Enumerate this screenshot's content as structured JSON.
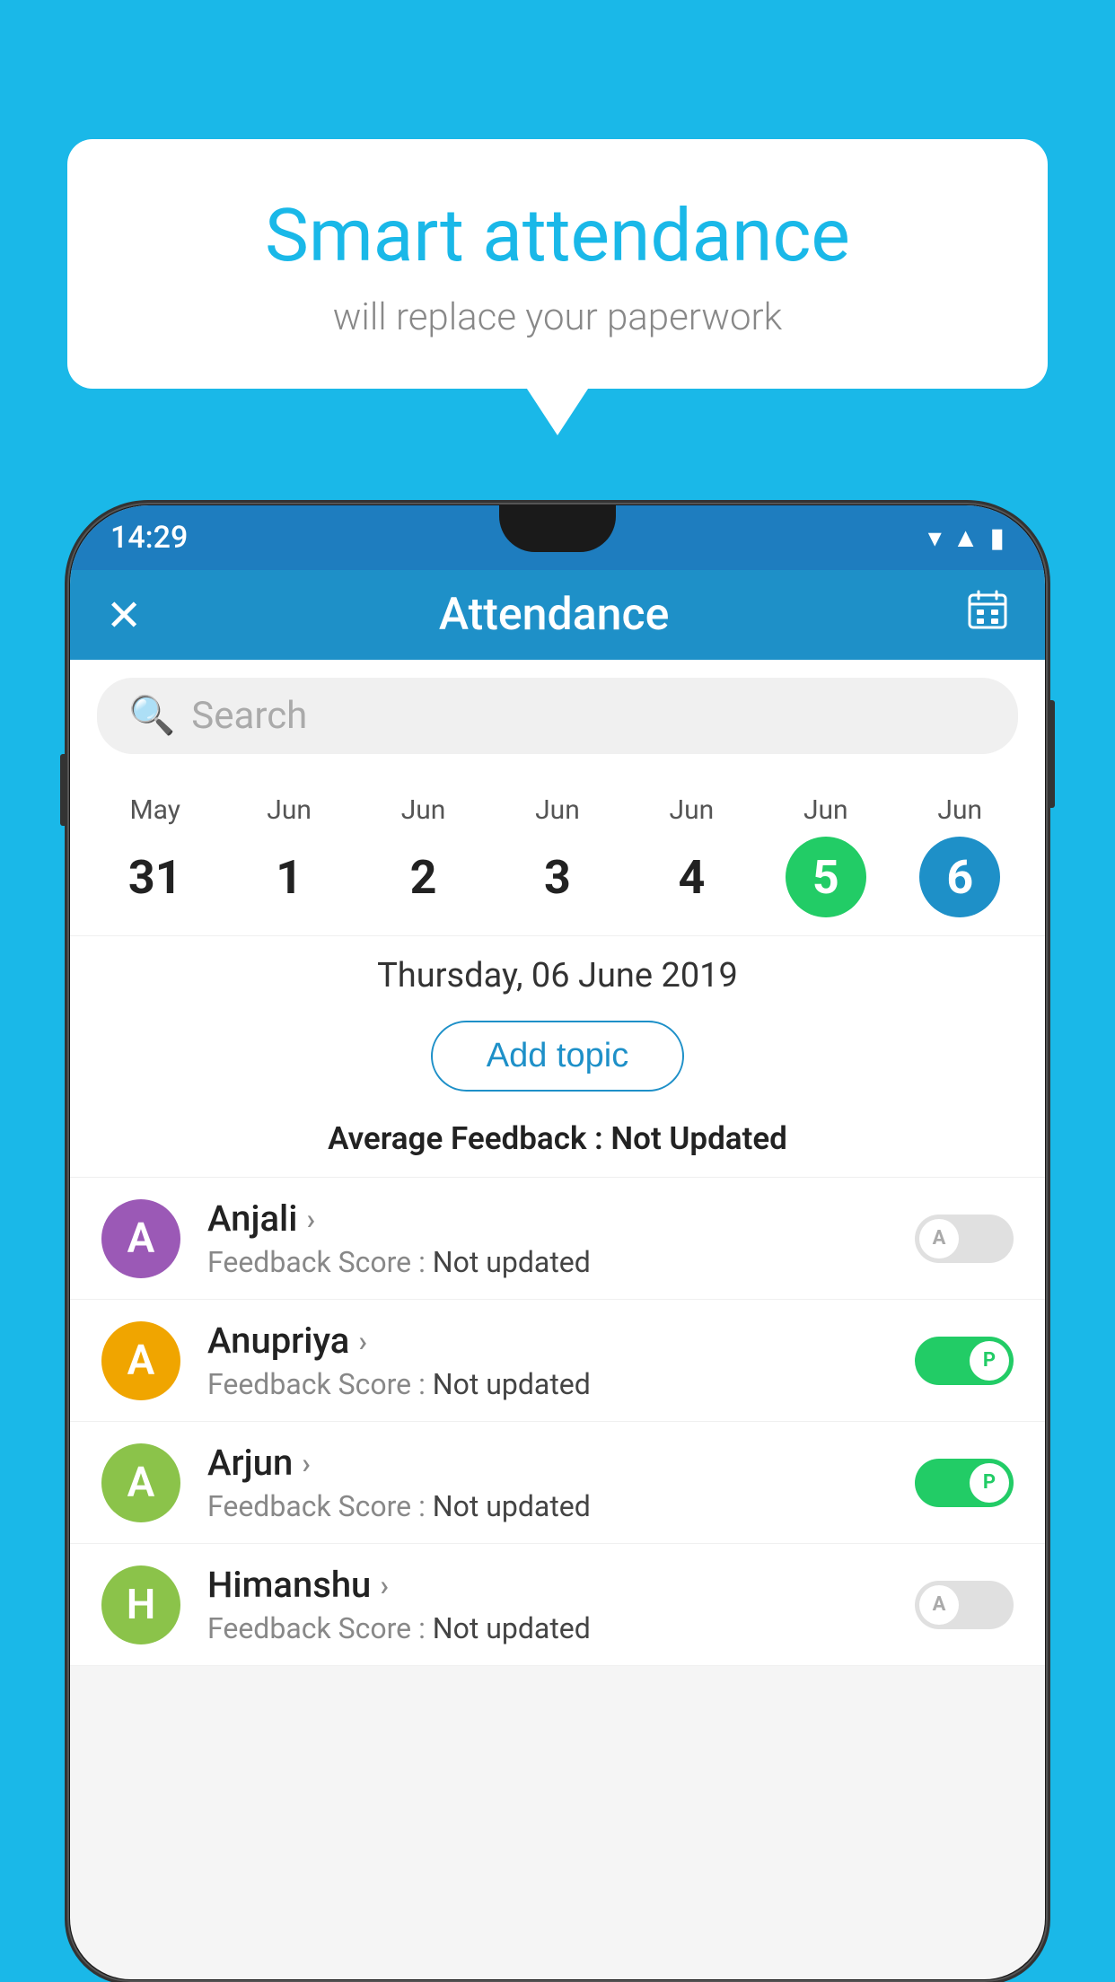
{
  "background_color": "#1ab8e8",
  "bubble": {
    "title": "Smart attendance",
    "subtitle": "will replace your paperwork"
  },
  "status_bar": {
    "time": "14:29"
  },
  "app_bar": {
    "title": "Attendance",
    "close_icon": "✕",
    "calendar_icon": "📅"
  },
  "search": {
    "placeholder": "Search"
  },
  "calendar": {
    "days": [
      {
        "month": "May",
        "day": "31",
        "state": "normal"
      },
      {
        "month": "Jun",
        "day": "1",
        "state": "normal"
      },
      {
        "month": "Jun",
        "day": "2",
        "state": "normal"
      },
      {
        "month": "Jun",
        "day": "3",
        "state": "normal"
      },
      {
        "month": "Jun",
        "day": "4",
        "state": "normal"
      },
      {
        "month": "Jun",
        "day": "5",
        "state": "today"
      },
      {
        "month": "Jun",
        "day": "6",
        "state": "selected"
      }
    ],
    "selected_date": "Thursday, 06 June 2019"
  },
  "add_topic_label": "Add topic",
  "avg_feedback_label": "Average Feedback :",
  "avg_feedback_value": "Not Updated",
  "students": [
    {
      "name": "Anjali",
      "avatar_letter": "A",
      "avatar_color": "#9b59b6",
      "feedback_label": "Feedback Score :",
      "feedback_value": "Not updated",
      "attendance": "absent",
      "toggle_label": "A"
    },
    {
      "name": "Anupriya",
      "avatar_letter": "A",
      "avatar_color": "#f0a500",
      "feedback_label": "Feedback Score :",
      "feedback_value": "Not updated",
      "attendance": "present",
      "toggle_label": "P"
    },
    {
      "name": "Arjun",
      "avatar_letter": "A",
      "avatar_color": "#8bc34a",
      "feedback_label": "Feedback Score :",
      "feedback_value": "Not updated",
      "attendance": "present",
      "toggle_label": "P"
    },
    {
      "name": "Himanshu",
      "avatar_letter": "H",
      "avatar_color": "#8bc34a",
      "feedback_label": "Feedback Score :",
      "feedback_value": "Not updated",
      "attendance": "absent",
      "toggle_label": "A"
    }
  ]
}
